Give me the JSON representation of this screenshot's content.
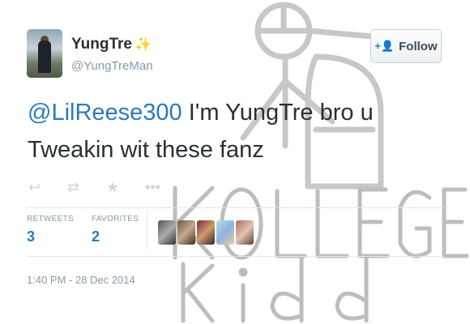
{
  "user": {
    "display_name": "YungTre",
    "emoji_icon": "sparkles-icon",
    "handle": "@YungTreMan"
  },
  "follow_button": {
    "label": "Follow",
    "icon": "add-user-icon"
  },
  "tweet": {
    "mention": "@LilReese300",
    "text": " I'm YungTre bro u Tweakin wit these fanz"
  },
  "actions": [
    "reply-icon",
    "retweet-icon",
    "favorite-icon",
    "more-icon"
  ],
  "stats": {
    "retweets_label": "RETWEETS",
    "retweets_value": "3",
    "favorites_label": "FAVORITES",
    "favorites_value": "2"
  },
  "timestamp": "1:40 PM - 28 Dec 2014",
  "watermark": {
    "text_line1": "KOLLEGE",
    "text_line2": "Kidd"
  },
  "colors": {
    "link": "#2b7bb9",
    "muted": "#8899a6",
    "text": "#292f33"
  }
}
